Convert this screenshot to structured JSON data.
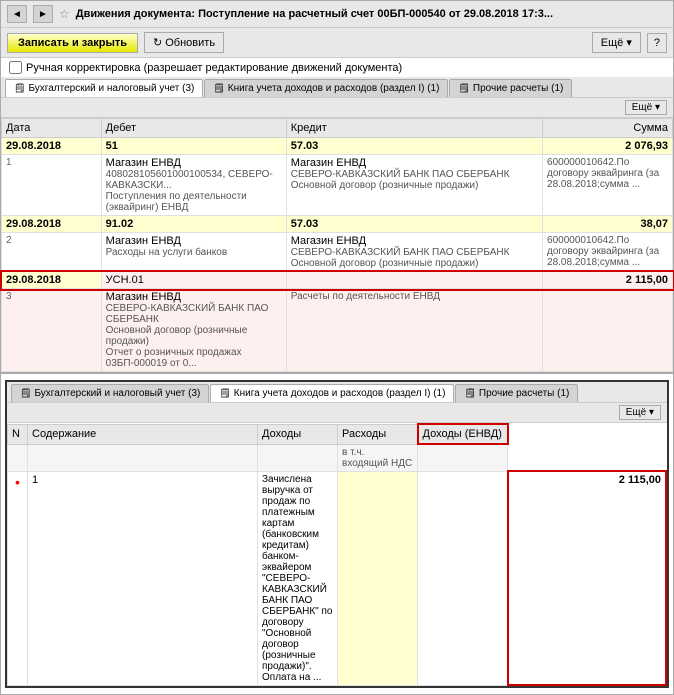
{
  "window": {
    "title": "Движения документа: Поступление на расчетный счет 00БП-000540 от 29.08.2018 17:3...",
    "nav_back": "◄",
    "nav_forward": "►",
    "star": "☆"
  },
  "toolbar": {
    "save_label": "Записать и закрыть",
    "refresh_label": "Обновить",
    "more_label": "Ещё ▾",
    "help_label": "?"
  },
  "checkbox": {
    "label": "Ручная корректировка (разрешает редактирование движений документа)"
  },
  "tabs": [
    {
      "label": "Бухгалтерский и налоговый учет (3)",
      "icon": "📋",
      "active": true
    },
    {
      "label": "Книга учета доходов и расходов (раздел I) (1)",
      "icon": "📋",
      "active": false
    },
    {
      "label": "Прочие расчеты (1)",
      "icon": "📋",
      "active": false
    }
  ],
  "eshche": "Ещё ▾",
  "table_headers": [
    "Дата",
    "Дебет",
    "Кредит",
    "Сумма"
  ],
  "rows": [
    {
      "type": "date",
      "date": "29.08.2018",
      "debet": "51",
      "kredit": "57.03",
      "summa": "2 076,93"
    },
    {
      "type": "sub",
      "num": "1",
      "debet_line1": "Магазин ЕНВД",
      "debet_line2": "408028105601000100534, СЕВЕРО-КАВКАЗСКИ...",
      "debet_line3": "Поступления по деятельности (эквайринг) ЕНВД",
      "kredit_line1": "Магазин ЕНВД",
      "kredit_line2": "СЕВЕРО-КАВКАЗСКИЙ БАНК ПАО СБЕРБАНК",
      "kredit_line3": "Основной договор (розничные продажи)",
      "summa": "600000010642.По договору эквайринга (за 28.08.2018;сумма ..."
    },
    {
      "type": "date",
      "date": "29.08.2018",
      "debet": "91.02",
      "kredit": "57.03",
      "summa": "38,07"
    },
    {
      "type": "sub",
      "num": "2",
      "debet_line1": "Магазин ЕНВД",
      "debet_line2": "Расходы на услуги банков",
      "debet_line3": "",
      "kredit_line1": "Магазин ЕНВД",
      "kredit_line2": "СЕВЕРО-КАВКАЗСКИЙ БАНК ПАО СБЕРБАНК",
      "kredit_line3": "Основной договор (розничные продажи)",
      "summa": "600000010642.По договору эквайринга (за 28.08.2018;сумма ..."
    },
    {
      "type": "highlighted_date",
      "date": "29.08.2018",
      "debet": "УСН.01",
      "kredit": "",
      "summa": "2 115,00"
    },
    {
      "type": "highlighted_sub",
      "num": "3",
      "debet_line1": "",
      "debet_line2": "Магазин ЕНВД",
      "debet_line3": "СЕВЕРО-КАВКАЗСКИЙ БАНК ПАО СБЕРБАНК",
      "debet_line4": "Основной договор (розничные продажи)",
      "debet_line5": "Отчет о розничных продажах 03БП-000019 от 0...",
      "kredit_line1": "Расчеты по деятельности ЕНВД",
      "summa": ""
    }
  ],
  "bottom_tabs": [
    {
      "label": "Бухгалтерский и налоговый учет (3)",
      "icon": "📋",
      "active": false
    },
    {
      "label": "Книга учета доходов и расходов (раздел I) (1)",
      "icon": "📋",
      "active": true
    },
    {
      "label": "Прочие расчеты (1)",
      "icon": "📋",
      "active": false
    }
  ],
  "bottom_eshche": "Ещё ▾",
  "bottom_headers": {
    "n": "N",
    "content": "Содержание",
    "dohody": "Доходы",
    "rashody": "Расходы",
    "dohody_envd": "Доходы (ЕНВД)"
  },
  "bottom_subheader": {
    "rashody": "в т.ч. входящий НДС"
  },
  "bottom_rows": [
    {
      "dot": "•",
      "num": "1",
      "content": "Зачислена выручка от продаж по платежным картам (банковским кредитам) банком-эквайером \"СЕВЕРО-КАВКАЗСКИЙ БАНК ПАО СБЕРБАНК\" по договору \"Основной договор (розничные продажи)\". Оплата на ...",
      "dohody": "",
      "rashody": "",
      "dohody_envd": "2 115,00"
    }
  ]
}
